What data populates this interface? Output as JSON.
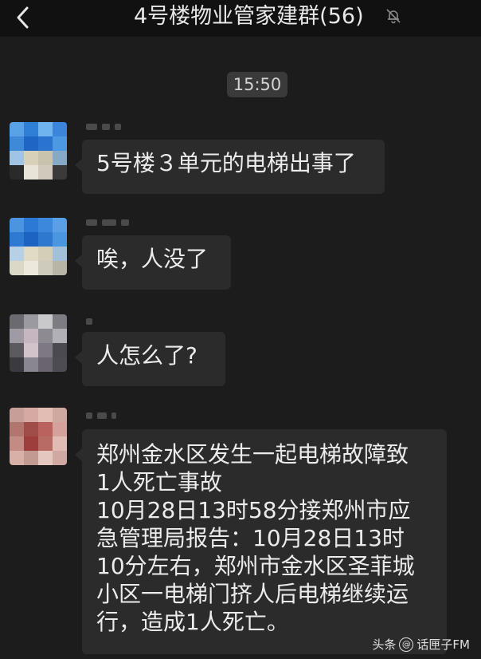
{
  "header": {
    "title": "4号楼物业管家建群(56)"
  },
  "timestamp": "15:50",
  "messages": [
    {
      "text_lines": [
        "5号楼３单元的电梯出事了"
      ]
    },
    {
      "text_lines": [
        "唉，人没了"
      ]
    },
    {
      "text_lines": [
        "人怎么了?"
      ]
    },
    {
      "text_lines": [
        "郑州金水区发生一起电梯故障致",
        "1人死亡事故",
        "10月28日13时58分接郑州市应",
        "急管理局报告：10月28日13时",
        "10分左右，郑州市金水区圣菲城",
        "小区一电梯门挤人后电梯继续运",
        "行，造成1人死亡。"
      ]
    }
  ],
  "watermark": {
    "brand": "头条",
    "handle": "话匣子FM"
  }
}
